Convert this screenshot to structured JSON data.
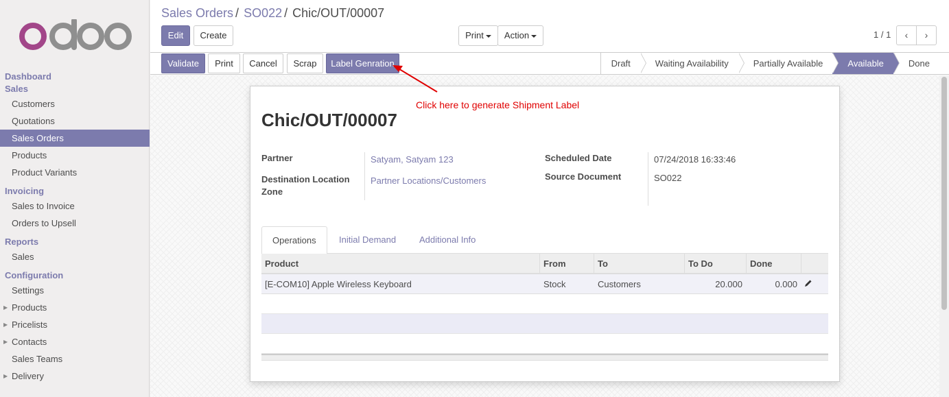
{
  "app": {
    "logo_text": "odoo"
  },
  "sidebar": {
    "sections": [
      {
        "title": "Dashboard"
      },
      {
        "title": "Sales",
        "items": [
          "Customers",
          "Quotations",
          "Sales Orders",
          "Products",
          "Product Variants"
        ]
      },
      {
        "title": "Invoicing",
        "items": [
          "Sales to Invoice",
          "Orders to Upsell"
        ]
      },
      {
        "title": "Reports",
        "items": [
          "Sales"
        ]
      },
      {
        "title": "Configuration",
        "items": [
          "Settings",
          "Products",
          "Pricelists",
          "Contacts",
          "Sales Teams",
          "Delivery"
        ]
      }
    ],
    "active_item": "Sales Orders"
  },
  "breadcrumb": {
    "items": [
      "Sales Orders",
      "SO022",
      "Chic/OUT/00007"
    ],
    "sep": "/"
  },
  "toolbar": {
    "edit": "Edit",
    "create": "Create",
    "print": "Print",
    "action": "Action",
    "pager": "1 / 1"
  },
  "statusbar": {
    "buttons": {
      "validate": "Validate",
      "print": "Print",
      "cancel": "Cancel",
      "scrap": "Scrap",
      "label": "Label Genration"
    },
    "stages": [
      "Draft",
      "Waiting Availability",
      "Partially Available",
      "Available",
      "Done"
    ],
    "active_stage": "Available"
  },
  "annotation": {
    "text": "Click here to generate Shipment Label",
    "color": "#e00000"
  },
  "form": {
    "title": "Chic/OUT/00007",
    "partner_label": "Partner",
    "partner_value": "Satyam, Satyam 123",
    "dest_label_1": "Destination Location",
    "dest_label_2": "Zone",
    "dest_value": "Partner Locations/Customers",
    "sched_label": "Scheduled Date",
    "sched_value": "07/24/2018 16:33:46",
    "source_label": "Source Document",
    "source_value": "SO022"
  },
  "tabs": [
    "Operations",
    "Initial Demand",
    "Additional Info"
  ],
  "table": {
    "headers": [
      "Product",
      "From",
      "To",
      "To Do",
      "Done"
    ],
    "rows": [
      {
        "product": "[E-COM10] Apple Wireless Keyboard",
        "from": "Stock",
        "to": "Customers",
        "todo": "20.000",
        "done": "0.000"
      }
    ]
  },
  "colors": {
    "accent": "#7c7bad"
  }
}
